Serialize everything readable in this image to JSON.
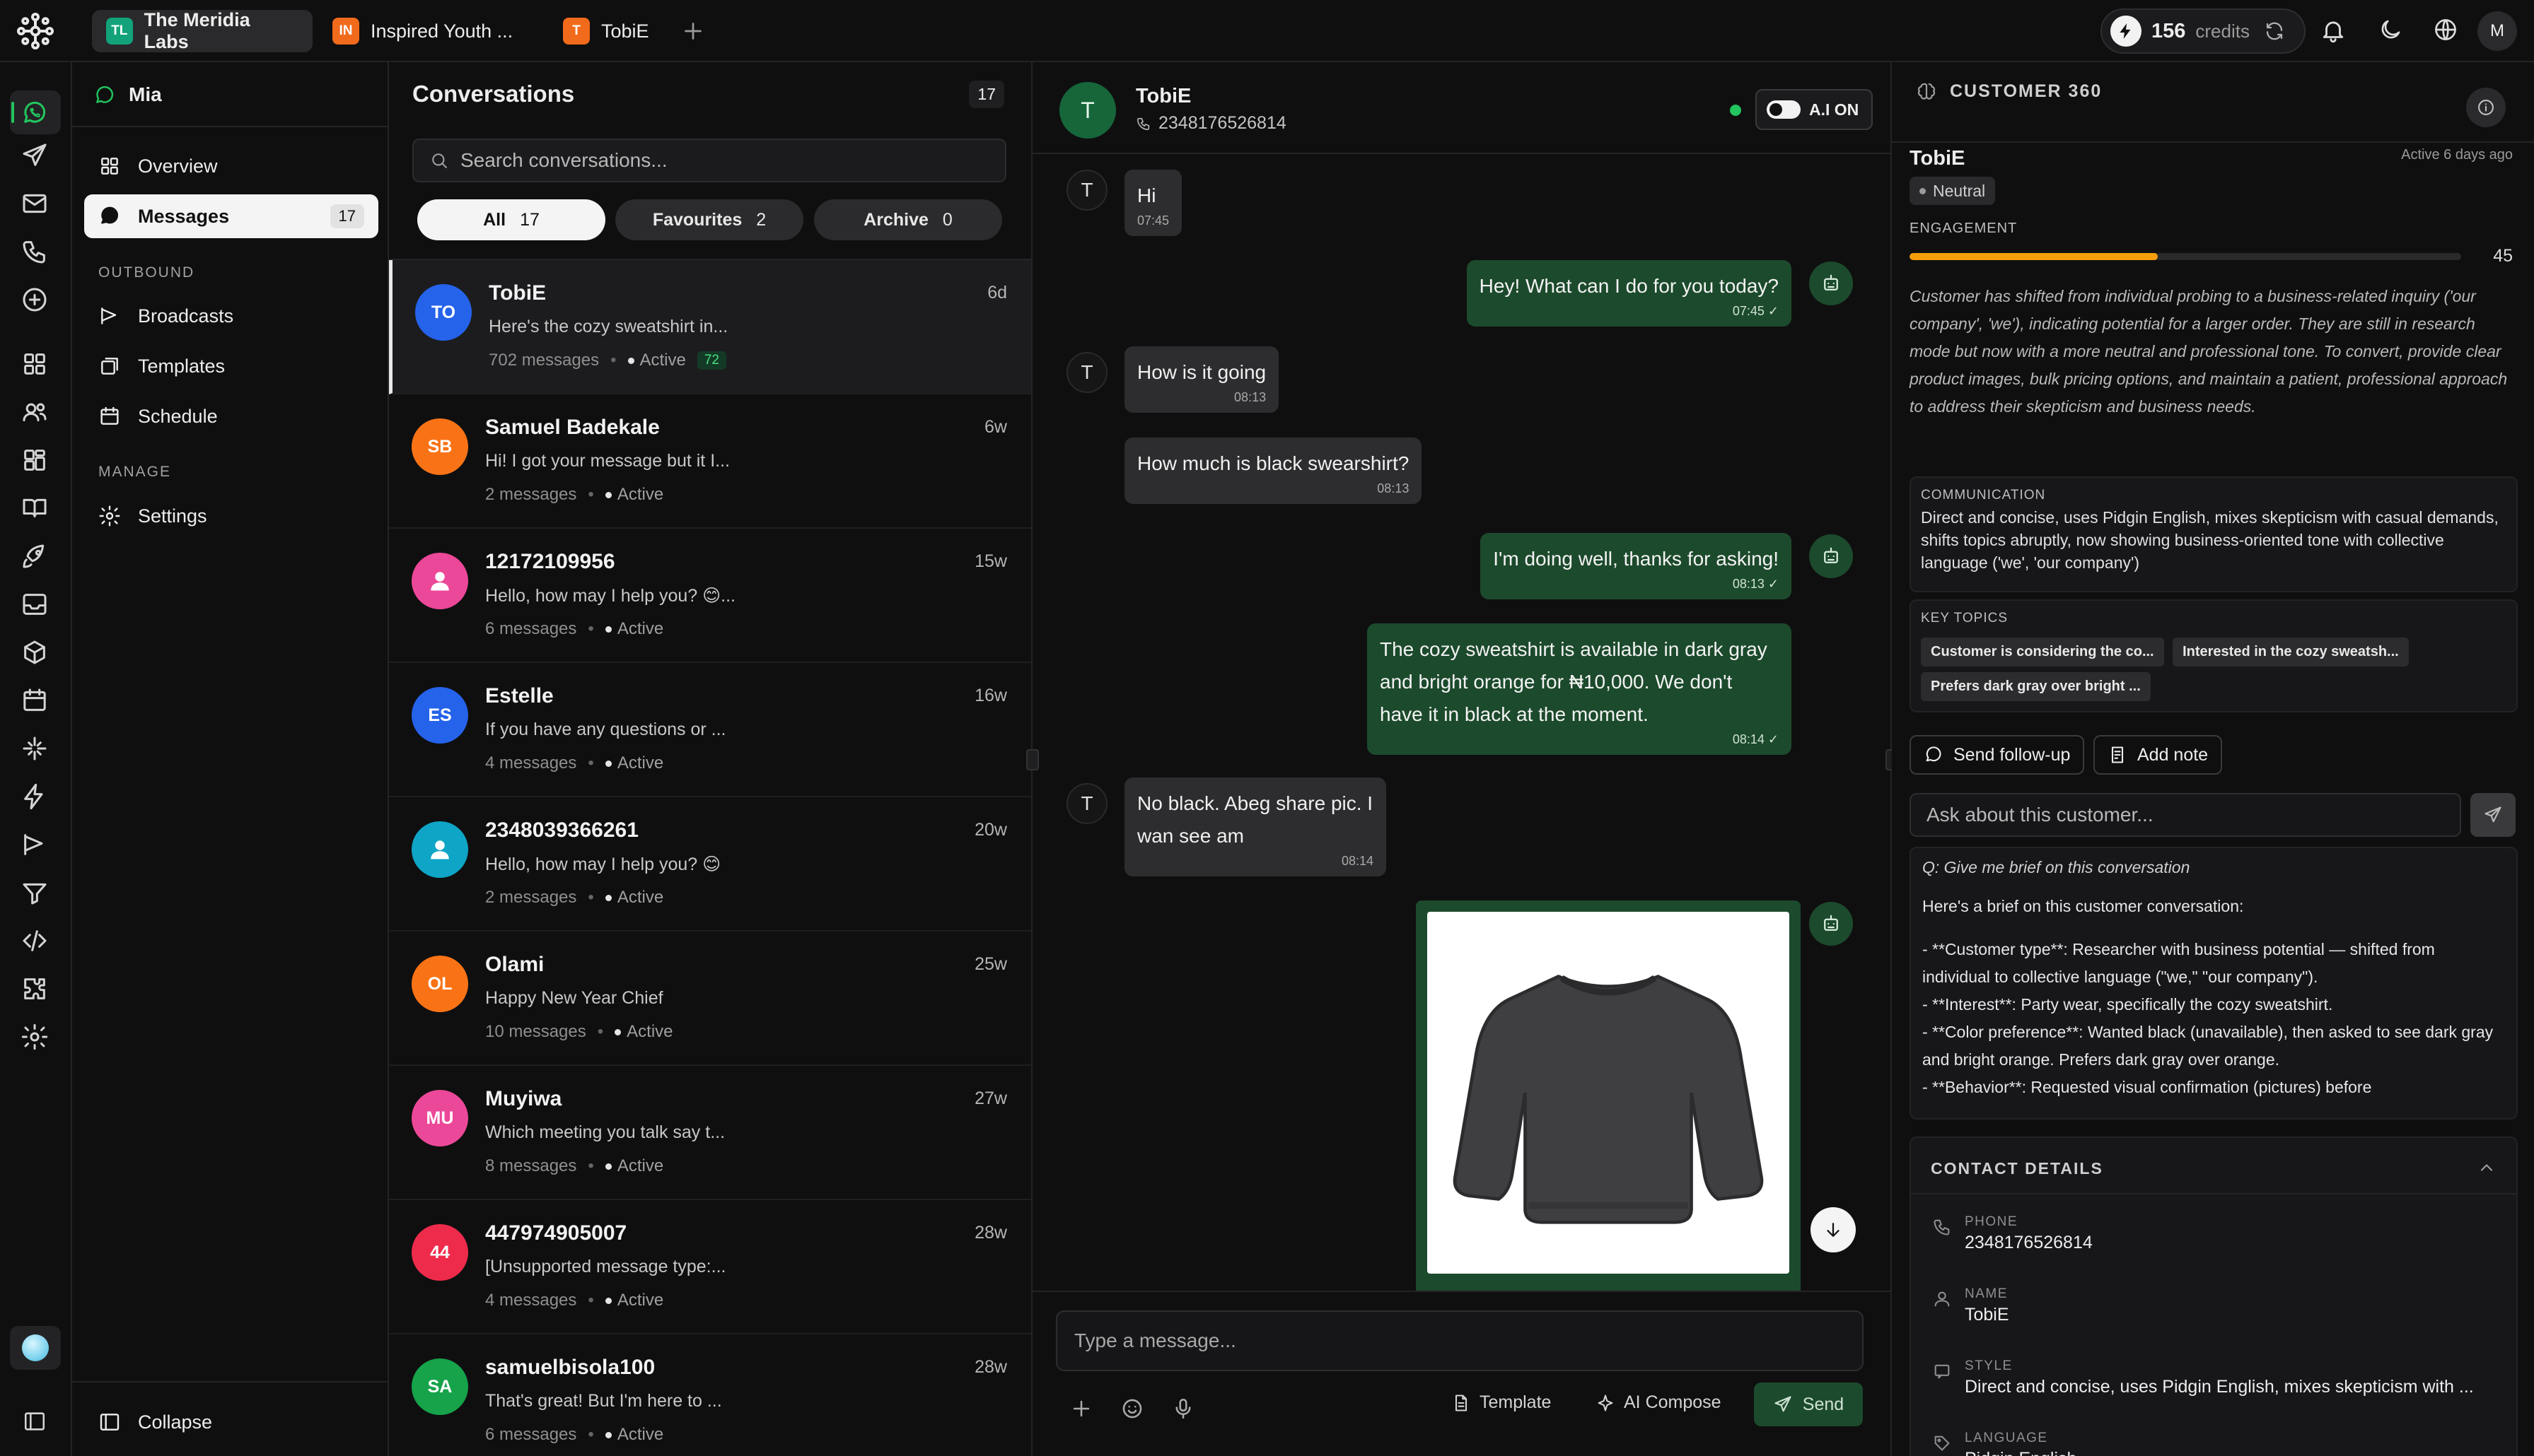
{
  "topbar": {
    "workspaces": [
      {
        "initials": "TL",
        "name": "The Meridia Labs",
        "color": "#12a37a"
      },
      {
        "initials": "IN",
        "name": "Inspired Youth ...",
        "color": "#f26a1b"
      },
      {
        "initials": "T",
        "name": "TobiE",
        "color": "#f26a1b"
      }
    ],
    "credits_value": "156",
    "credits_label": "credits",
    "user_initial": "M"
  },
  "nav": {
    "agent_name": "Mia",
    "items": [
      {
        "label": "Overview"
      },
      {
        "label": "Messages",
        "count": "17"
      }
    ],
    "outbound_label": "OUTBOUND",
    "outbound_items": [
      {
        "label": "Broadcasts"
      },
      {
        "label": "Templates"
      },
      {
        "label": "Schedule"
      }
    ],
    "manage_label": "MANAGE",
    "manage_items": [
      {
        "label": "Settings"
      }
    ],
    "collapse_label": "Collapse"
  },
  "conversations": {
    "title": "Conversations",
    "count": "17",
    "search_placeholder": "Search conversations...",
    "filters": [
      {
        "label": "All",
        "count": "17"
      },
      {
        "label": "Favourites",
        "count": "2"
      },
      {
        "label": "Archive",
        "count": "0"
      }
    ],
    "items": [
      {
        "initials": "TO",
        "color": "#2563eb",
        "name": "TobiE",
        "time": "6d",
        "preview": "Here's the cozy sweatshirt in...",
        "messages": "702 messages",
        "status": "Active",
        "badge": "72"
      },
      {
        "initials": "SB",
        "color": "#f97316",
        "name": "Samuel Badekale",
        "time": "6w",
        "preview": "Hi! I got your message but it I...",
        "messages": "2 messages",
        "status": "Active"
      },
      {
        "initials": "",
        "color": "#ec4899",
        "name": "12172109956",
        "time": "15w",
        "preview": "Hello, how may I help you? 😊...",
        "messages": "6 messages",
        "status": "Active",
        "person": true
      },
      {
        "initials": "ES",
        "color": "#2563eb",
        "name": "Estelle",
        "time": "16w",
        "preview": "If you have any questions or ...",
        "messages": "4 messages",
        "status": "Active"
      },
      {
        "initials": "",
        "color": "#0ea5c6",
        "name": "2348039366261",
        "time": "20w",
        "preview": "Hello, how may I help you? 😊",
        "messages": "2 messages",
        "status": "Active",
        "person": true
      },
      {
        "initials": "OL",
        "color": "#f97316",
        "name": "Olami",
        "time": "25w",
        "preview": "Happy New Year Chief",
        "messages": "10 messages",
        "status": "Active"
      },
      {
        "initials": "MU",
        "color": "#ec4899",
        "name": "Muyiwa",
        "time": "27w",
        "preview": "Which meeting you talk say t...",
        "messages": "8 messages",
        "status": "Active"
      },
      {
        "initials": "44",
        "color": "#ef2b4b",
        "name": "447974905007",
        "time": "28w",
        "preview": "[Unsupported message type:...",
        "messages": "4 messages",
        "status": "Active"
      },
      {
        "initials": "SA",
        "color": "#16a34a",
        "name": "samuelbisola100",
        "time": "28w",
        "preview": "That's great! But I'm here to ...",
        "messages": "6 messages",
        "status": "Active"
      }
    ]
  },
  "chat": {
    "contact_initial": "T",
    "contact_name": "TobiE",
    "contact_phone": "2348176526814",
    "ai_label": "A.I ON",
    "messages": [
      {
        "dir": "in",
        "text": "Hi",
        "time": "07:45"
      },
      {
        "dir": "out",
        "text": "Hey! What can I do for you today?",
        "time": "07:45"
      },
      {
        "dir": "in",
        "text": "How is it going",
        "time": "08:13"
      },
      {
        "dir": "in",
        "text": "How much is black swearshirt?",
        "time": "08:13"
      },
      {
        "dir": "out",
        "text": "I'm doing well, thanks for asking!",
        "time": "08:13"
      },
      {
        "dir": "out",
        "text": "The cozy sweatshirt is available in dark gray and bright orange for ₦10,000. We don't have it in black at the moment.",
        "time": "08:14"
      },
      {
        "dir": "in",
        "text": "No black. Abeg share pic. I wan see am",
        "time": "08:14"
      }
    ],
    "input_placeholder": "Type a message...",
    "template_label": "Template",
    "compose_label": "AI Compose",
    "send_label": "Send"
  },
  "customer": {
    "header": "CUSTOMER 360",
    "name": "TobiE",
    "last_active": "Active 6 days ago",
    "sentiment": "Neutral",
    "engagement_label": "ENGAGEMENT",
    "engagement_score": "45",
    "engagement_fraction": 0.45,
    "summary": "Customer has shifted from individual probing to a business-related inquiry ('our company', 'we'), indicating potential for a larger order. They are still in research mode but now with a more neutral and professional tone. To convert, provide clear product images, bulk pricing options, and maintain a patient, professional approach to address their skepticism and business needs.",
    "communication_label": "COMMUNICATION",
    "communication_text": "Direct and concise, uses Pidgin English, mixes skepticism with casual demands, shifts topics abruptly, now showing business-oriented tone with collective language ('we', 'our company')",
    "key_topics_label": "KEY TOPICS",
    "key_topics": [
      "Customer is considering the co...",
      "Interested in the cozy sweatsh...",
      "Prefers dark gray over bright ..."
    ],
    "followup_label": "Send follow-up",
    "note_label": "Add note",
    "ask_placeholder": "Ask about this customer...",
    "question": "Q: Give me brief on this conversation",
    "answer_intro": "Here's a brief on this customer conversation:",
    "answer_lines": [
      "- **Customer type**: Researcher with business potential — shifted from individual to collective language (\"we,\" \"our company\").",
      "- **Interest**: Party wear, specifically the cozy sweatshirt.",
      "- **Color preference**: Wanted black (unavailable), then asked to see dark gray and bright orange. Prefers dark gray over orange.",
      "- **Behavior**: Requested visual confirmation (pictures) before"
    ],
    "contact_details_label": "CONTACT DETAILS",
    "contact": [
      {
        "label": "PHONE",
        "value": "2348176526814",
        "icon": "phone-icon"
      },
      {
        "label": "NAME",
        "value": "TobiE",
        "icon": "user-icon"
      },
      {
        "label": "STYLE",
        "value": "Direct and concise, uses Pidgin English, mixes skepticism with ...",
        "icon": "chat-icon"
      },
      {
        "label": "LANGUAGE",
        "value": "Pidgin English",
        "icon": "tag-icon"
      }
    ]
  },
  "colors": {
    "accent_green": "#1c4a2c",
    "engagement_orange": "#f59e0b",
    "online_green": "#22c55e"
  }
}
